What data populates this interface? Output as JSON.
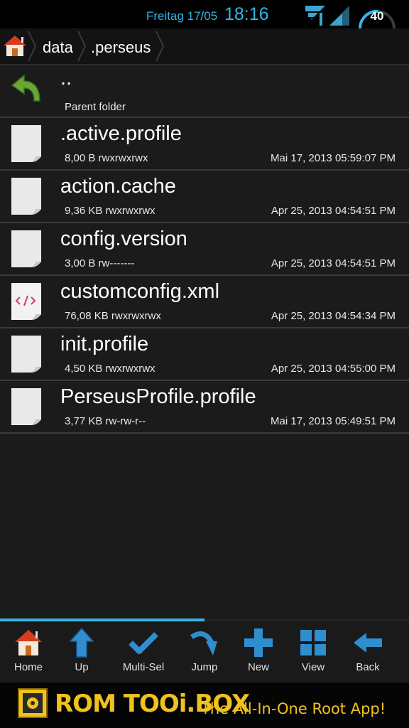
{
  "status_bar": {
    "date": "Freitag 17/05",
    "time": "18:16",
    "battery_level": "40",
    "icons": [
      "wifi-icon",
      "signal-icon",
      "battery-icon"
    ]
  },
  "breadcrumb": {
    "home_icon": "home-icon",
    "items": [
      ".perseus",
      "data"
    ]
  },
  "parent_row": {
    "name": "..",
    "label": "Parent folder",
    "icon": "parent-folder-arrow-icon"
  },
  "files": [
    {
      "name": ".active.profile",
      "size_perms": "8,00 B rwxrwxrwx",
      "date": "Mai 17, 2013 05:59:07 PM",
      "icon": "file-icon"
    },
    {
      "name": "action.cache",
      "size_perms": "9,36 KB rwxrwxrwx",
      "date": "Apr 25, 2013 04:54:51 PM",
      "icon": "file-icon"
    },
    {
      "name": "config.version",
      "size_perms": "3,00 B rw-------",
      "date": "Apr 25, 2013 04:54:51 PM",
      "icon": "file-icon"
    },
    {
      "name": "customconfig.xml",
      "size_perms": "76,08 KB rwxrwxrwx",
      "date": "Apr 25, 2013 04:54:34 PM",
      "icon": "xml-file-icon"
    },
    {
      "name": "init.profile",
      "size_perms": "4,50 KB rwxrwxrwx",
      "date": "Apr 25, 2013 04:55:00 PM",
      "icon": "file-icon"
    },
    {
      "name": "PerseusProfile.profile",
      "size_perms": "3,77 KB rw-rw-r--",
      "date": "Mai 17, 2013 05:49:51 PM",
      "icon": "file-icon"
    }
  ],
  "scroll_progress": 0.5,
  "toolbar": {
    "items": [
      {
        "label": "Home",
        "icon": "home-icon"
      },
      {
        "label": "Up",
        "icon": "up-arrow-icon"
      },
      {
        "label": "Multi-Sel",
        "icon": "checkmark-icon"
      },
      {
        "label": "Jump",
        "icon": "jump-arrow-icon"
      },
      {
        "label": "New",
        "icon": "plus-icon"
      },
      {
        "label": "View",
        "icon": "grid-view-icon"
      },
      {
        "label": "Back",
        "icon": "back-arrow-icon"
      }
    ]
  },
  "ad_banner": {
    "brand": "ROM TOOi.BOX",
    "tagline": "The All-In-One Root App!"
  },
  "colors": {
    "accent": "#33b5e5",
    "background": "#1b1b1b",
    "brand_yellow": "#f0c21c"
  }
}
